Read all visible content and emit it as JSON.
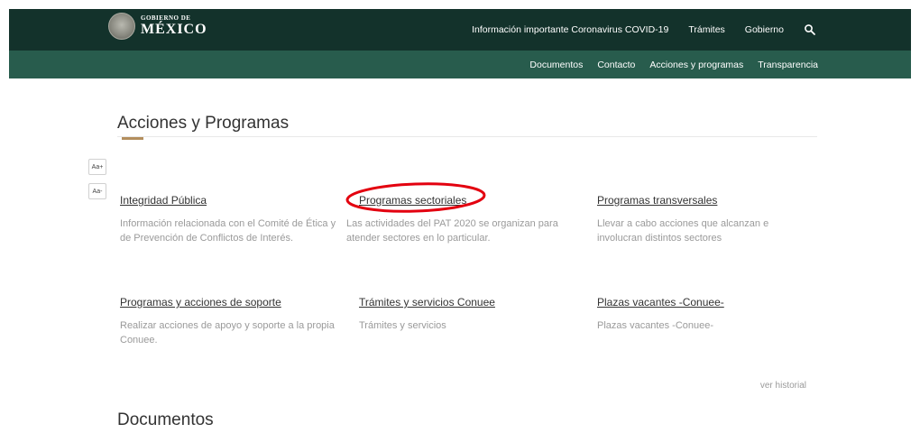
{
  "header": {
    "logo": {
      "small": "GOBIERNO DE",
      "big": "MÉXICO"
    },
    "top_nav": [
      "Información importante Coronavirus COVID-19",
      "Trámites",
      "Gobierno"
    ],
    "search_icon": "search-icon",
    "sub_nav": [
      "Documentos",
      "Contacto",
      "Acciones y programas",
      "Transparencia"
    ]
  },
  "main": {
    "section_title": "Acciones y Programas",
    "font_controls": [
      "Aa+",
      "Aa-"
    ],
    "cards": [
      {
        "title": "Integridad Pública",
        "description": "Información relacionada con el Comité de Ética y de Prevención de Conflictos de Interés."
      },
      {
        "title": "Programas sectoriales",
        "description": "Las actividades del PAT 2020 se organizan para atender sectores en lo particular."
      },
      {
        "title": "Programas transversales",
        "description": "Llevar a cabo acciones que alcanzan e involucran distintos sectores"
      },
      {
        "title": "Programas y acciones de soporte",
        "description": "Realizar acciones de apoyo y soporte a la propia Conuee."
      },
      {
        "title": "Trámites y servicios Conuee",
        "description": "Trámites y servicios"
      },
      {
        "title": "Plazas vacantes -Conuee-",
        "description": "Plazas vacantes -Conuee-"
      }
    ],
    "view_history": "ver historial",
    "documents_title": "Documentos"
  },
  "colors": {
    "header_dark": "#13322b",
    "header_sub": "#285c4d",
    "accent": "#b38e5d",
    "highlight": "#e3000f"
  }
}
